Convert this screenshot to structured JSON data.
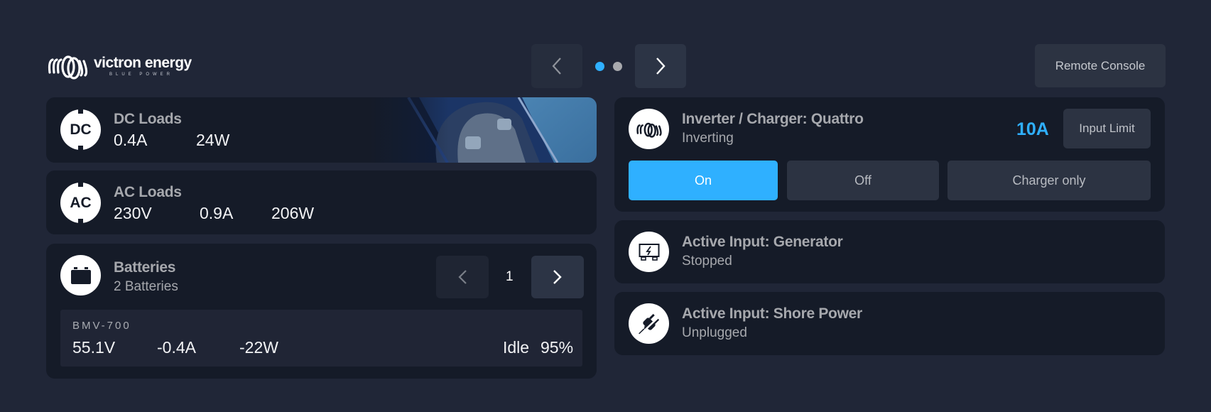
{
  "header": {
    "logo": {
      "name": "victron energy",
      "tagline": "BLUE POWER"
    },
    "pager": {
      "prev_icon": "chevron-left-icon",
      "next_icon": "chevron-right-icon",
      "page_count": 2,
      "active_page": 1
    },
    "remote_console_label": "Remote Console"
  },
  "colors": {
    "accent": "#2fb0ff",
    "dot_inactive": "#a8a9ad",
    "background": "#202637",
    "card": "#151b28"
  },
  "dc_loads": {
    "icon_label": "DC",
    "title": "DC Loads",
    "current": "0.4A",
    "power": "24W"
  },
  "ac_loads": {
    "icon_label": "AC",
    "title": "AC Loads",
    "voltage": "230V",
    "current": "0.9A",
    "power": "206W"
  },
  "batteries": {
    "title": "Batteries",
    "subtitle": "2 Batteries",
    "page": "1",
    "device": {
      "name": "BMV-700",
      "voltage": "55.1V",
      "current": "-0.4A",
      "power": "-22W",
      "state": "Idle",
      "soc": "95%"
    }
  },
  "inverter": {
    "title": "Inverter / Charger: Quattro",
    "status": "Inverting",
    "input_limit_value": "10A",
    "input_limit_label": "Input Limit",
    "modes": [
      {
        "label": "On",
        "selected": true
      },
      {
        "label": "Off",
        "selected": false
      },
      {
        "label": "Charger only",
        "selected": false
      }
    ]
  },
  "generator": {
    "title": "Active Input: Generator",
    "status": "Stopped"
  },
  "shore_power": {
    "title": "Active Input: Shore Power",
    "status": "Unplugged"
  }
}
